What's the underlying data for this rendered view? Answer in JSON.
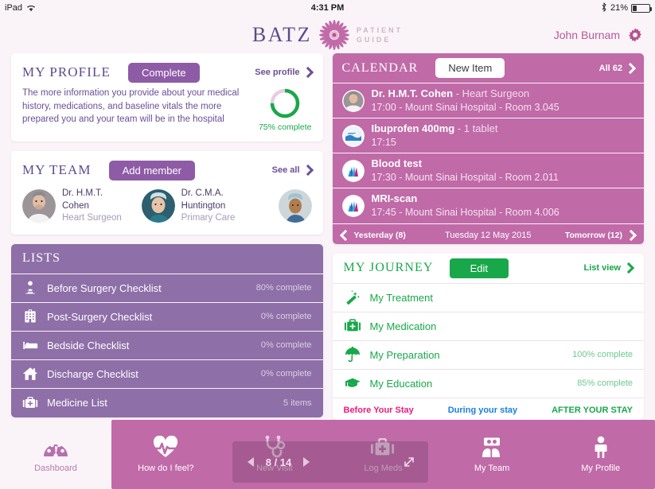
{
  "statusbar": {
    "device": "iPad",
    "wifi_icon": "wifi-icon",
    "time": "4:31 PM",
    "bluetooth_icon": "bluetooth-icon",
    "battery_percent": "21%",
    "battery_level": 21
  },
  "header": {
    "brand": "BATZ",
    "brand_sub_line1": "PATIENT",
    "brand_sub_line2": "GUIDE",
    "logo_icon": "flower-logo-icon",
    "user_name": "John Burnam",
    "settings_icon": "gear-icon",
    "brand_color": "#5d4b8c",
    "accent_pink": "#b65a9b"
  },
  "profile": {
    "title": "MY PROFILE",
    "action_label": "Complete",
    "link_label": "See profile",
    "link_icon": "chevron-right-icon",
    "body": "The more information you provide about your medical history, medications, and baseline vitals the more prepared you and your team will be in the hospital",
    "progress_label": "75% complete",
    "progress_value": 75,
    "progress_color": "#18a84a"
  },
  "team": {
    "title": "MY TEAM",
    "action_label": "Add member",
    "link_label": "See all",
    "link_icon": "chevron-right-icon",
    "members": [
      {
        "name": "Dr. H.M.T. Cohen",
        "role": "Heart Surgeon",
        "avatar_icon": "avatar-cohen"
      },
      {
        "name": "Dr. C.M.A. Huntington",
        "role": "Primary Care",
        "avatar_icon": "avatar-huntington"
      },
      {
        "name": "",
        "role": "",
        "avatar_icon": "avatar-third-member"
      }
    ]
  },
  "lists": {
    "title": "LISTS",
    "card_color": "#8e6fa8",
    "items": [
      {
        "label": "Before Surgery Checklist",
        "meta": "80% complete",
        "icon": "doctor-icon"
      },
      {
        "label": "Post-Surgery Checklist",
        "meta": "0% complete",
        "icon": "hospital-icon"
      },
      {
        "label": "Bedside Checklist",
        "meta": "0% complete",
        "icon": "bed-icon"
      },
      {
        "label": "Discharge Checklist",
        "meta": "0% complete",
        "icon": "home-icon"
      },
      {
        "label": "Medicine List",
        "meta": "5 items",
        "icon": "medical-kit-icon"
      }
    ]
  },
  "calendar": {
    "title": "CALENDAR",
    "action_label": "New Item",
    "link_label": "All 62",
    "link_icon": "chevron-right-icon",
    "card_color": "#c06aa8",
    "events": [
      {
        "icon": "avatar-cohen",
        "title_main": "Dr. H.M.T. Cohen",
        "title_rest": " - Heart Surgeon",
        "subtitle": "17:00 - Mount Sinai Hospital - Room 3.045"
      },
      {
        "icon": "pill-box-icon",
        "title_main": "Ibuprofen 400mg",
        "title_rest": " - 1 tablet",
        "subtitle": "17:15"
      },
      {
        "icon": "hospital-logo-icon",
        "title_main": "Blood test",
        "title_rest": "",
        "subtitle": "17:30 - Mount Sinai Hospital - Room 2.011"
      },
      {
        "icon": "hospital-logo-icon",
        "title_main": "MRI-scan",
        "title_rest": "",
        "subtitle": "17:45 - Mount Sinai Hospital - Room 4.006"
      }
    ],
    "prev_label": "Yesterday (8)",
    "current_label": "Tuesday 12 May 2015",
    "next_label": "Tomorrow (12)",
    "prev_icon": "chevron-left-icon",
    "next_icon": "chevron-right-icon"
  },
  "journey": {
    "title": "MY JOURNEY",
    "action_label": "Edit",
    "link_label": "List view",
    "link_icon": "chevron-right-icon",
    "accent_color": "#18a84a",
    "items": [
      {
        "label": "My Treatment",
        "meta": "",
        "icon": "magic-wand-icon"
      },
      {
        "label": "My Medication",
        "meta": "",
        "icon": "medical-kit-icon"
      },
      {
        "label": "My Preparation",
        "meta": "100% complete",
        "icon": "umbrella-icon"
      },
      {
        "label": "My Education",
        "meta": "85% complete",
        "icon": "graduation-cap-icon"
      }
    ],
    "stages": [
      {
        "label": "Before Your Stay",
        "color": "#f0197a"
      },
      {
        "label": "During your stay",
        "color": "#1a7fe0"
      },
      {
        "label": "AFTER YOUR STAY",
        "color": "#18a84a"
      }
    ]
  },
  "tabbar": {
    "bar_color": "#c06aa8",
    "tabs": [
      {
        "label": "Dashboard",
        "icon": "dashboard-gauge-icon",
        "active": true
      },
      {
        "label": "How do I feel?",
        "icon": "heart-pulse-icon",
        "active": false
      },
      {
        "label": "New Visit",
        "icon": "stethoscope-icon",
        "active": false
      },
      {
        "label": "Log Meds",
        "icon": "medical-kit-icon",
        "active": false
      },
      {
        "label": "My Team",
        "icon": "people-icon",
        "active": false
      },
      {
        "label": "My Profile",
        "icon": "person-icon",
        "active": false
      }
    ]
  },
  "overlay": {
    "page_indicator": "8 / 14",
    "prev_icon": "triangle-left-icon",
    "next_icon": "triangle-right-icon",
    "resize_icon": "diagonal-resize-icon"
  }
}
